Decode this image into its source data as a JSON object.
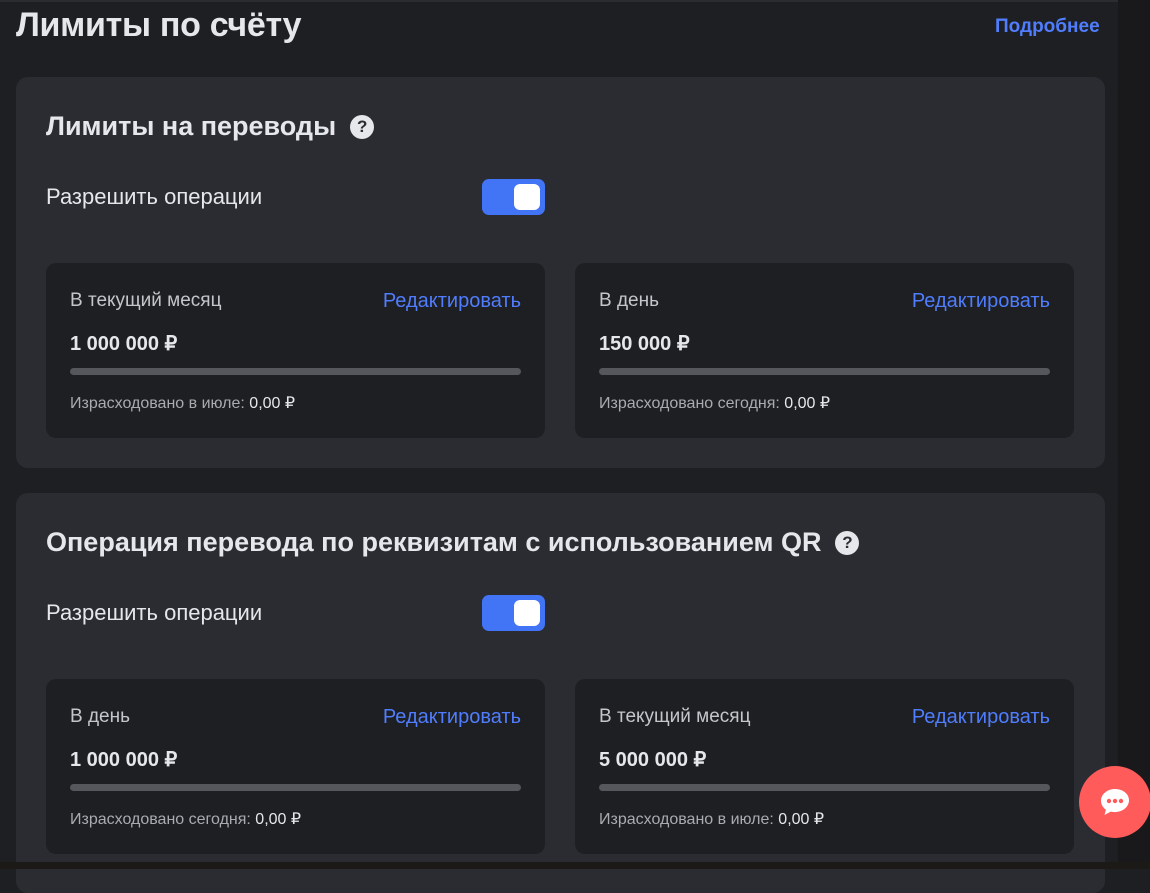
{
  "page": {
    "title": "Лимиты по счёту",
    "more_link": "Подробнее"
  },
  "sections": [
    {
      "title": "Лимиты на переводы",
      "allow_label": "Разрешить операции",
      "allow_enabled": true,
      "cards": [
        {
          "label": "В текущий месяц",
          "edit": "Редактировать",
          "amount": "1 000 000 ₽",
          "spent_label": "Израсходовано в июле:",
          "spent_value": "0,00 ₽",
          "progress": 0
        },
        {
          "label": "В день",
          "edit": "Редактировать",
          "amount": "150 000 ₽",
          "spent_label": "Израсходовано сегодня:",
          "spent_value": "0,00 ₽",
          "progress": 0
        }
      ]
    },
    {
      "title": "Операция перевода по реквизитам с использованием QR",
      "allow_label": "Разрешить операции",
      "allow_enabled": true,
      "cards": [
        {
          "label": "В день",
          "edit": "Редактировать",
          "amount": "1 000 000 ₽",
          "spent_label": "Израсходовано сегодня:",
          "spent_value": "0,00 ₽",
          "progress": 0
        },
        {
          "label": "В текущий месяц",
          "edit": "Редактировать",
          "amount": "5 000 000 ₽",
          "spent_label": "Израсходовано в июле:",
          "spent_value": "0,00 ₽",
          "progress": 0
        }
      ]
    }
  ],
  "icons": {
    "help": "?",
    "chat": "chat-bubble-icon"
  },
  "colors": {
    "accent": "#4f7dfd",
    "toggle_on": "#4274f6",
    "chat_button": "#ff5b5b",
    "background": "#1e1f22",
    "panel": "#2b2c31"
  }
}
